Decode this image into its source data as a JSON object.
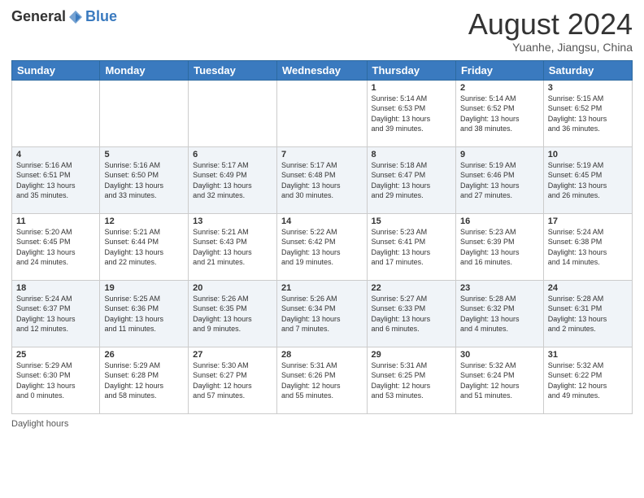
{
  "logo": {
    "general": "General",
    "blue": "Blue"
  },
  "header": {
    "month": "August 2024",
    "location": "Yuanhe, Jiangsu, China"
  },
  "days_of_week": [
    "Sunday",
    "Monday",
    "Tuesday",
    "Wednesday",
    "Thursday",
    "Friday",
    "Saturday"
  ],
  "legend": {
    "label": "Daylight hours"
  },
  "weeks": [
    [
      {
        "day": "",
        "info": ""
      },
      {
        "day": "",
        "info": ""
      },
      {
        "day": "",
        "info": ""
      },
      {
        "day": "",
        "info": ""
      },
      {
        "day": "1",
        "info": "Sunrise: 5:14 AM\nSunset: 6:53 PM\nDaylight: 13 hours\nand 39 minutes."
      },
      {
        "day": "2",
        "info": "Sunrise: 5:14 AM\nSunset: 6:52 PM\nDaylight: 13 hours\nand 38 minutes."
      },
      {
        "day": "3",
        "info": "Sunrise: 5:15 AM\nSunset: 6:52 PM\nDaylight: 13 hours\nand 36 minutes."
      }
    ],
    [
      {
        "day": "4",
        "info": "Sunrise: 5:16 AM\nSunset: 6:51 PM\nDaylight: 13 hours\nand 35 minutes."
      },
      {
        "day": "5",
        "info": "Sunrise: 5:16 AM\nSunset: 6:50 PM\nDaylight: 13 hours\nand 33 minutes."
      },
      {
        "day": "6",
        "info": "Sunrise: 5:17 AM\nSunset: 6:49 PM\nDaylight: 13 hours\nand 32 minutes."
      },
      {
        "day": "7",
        "info": "Sunrise: 5:17 AM\nSunset: 6:48 PM\nDaylight: 13 hours\nand 30 minutes."
      },
      {
        "day": "8",
        "info": "Sunrise: 5:18 AM\nSunset: 6:47 PM\nDaylight: 13 hours\nand 29 minutes."
      },
      {
        "day": "9",
        "info": "Sunrise: 5:19 AM\nSunset: 6:46 PM\nDaylight: 13 hours\nand 27 minutes."
      },
      {
        "day": "10",
        "info": "Sunrise: 5:19 AM\nSunset: 6:45 PM\nDaylight: 13 hours\nand 26 minutes."
      }
    ],
    [
      {
        "day": "11",
        "info": "Sunrise: 5:20 AM\nSunset: 6:45 PM\nDaylight: 13 hours\nand 24 minutes."
      },
      {
        "day": "12",
        "info": "Sunrise: 5:21 AM\nSunset: 6:44 PM\nDaylight: 13 hours\nand 22 minutes."
      },
      {
        "day": "13",
        "info": "Sunrise: 5:21 AM\nSunset: 6:43 PM\nDaylight: 13 hours\nand 21 minutes."
      },
      {
        "day": "14",
        "info": "Sunrise: 5:22 AM\nSunset: 6:42 PM\nDaylight: 13 hours\nand 19 minutes."
      },
      {
        "day": "15",
        "info": "Sunrise: 5:23 AM\nSunset: 6:41 PM\nDaylight: 13 hours\nand 17 minutes."
      },
      {
        "day": "16",
        "info": "Sunrise: 5:23 AM\nSunset: 6:39 PM\nDaylight: 13 hours\nand 16 minutes."
      },
      {
        "day": "17",
        "info": "Sunrise: 5:24 AM\nSunset: 6:38 PM\nDaylight: 13 hours\nand 14 minutes."
      }
    ],
    [
      {
        "day": "18",
        "info": "Sunrise: 5:24 AM\nSunset: 6:37 PM\nDaylight: 13 hours\nand 12 minutes."
      },
      {
        "day": "19",
        "info": "Sunrise: 5:25 AM\nSunset: 6:36 PM\nDaylight: 13 hours\nand 11 minutes."
      },
      {
        "day": "20",
        "info": "Sunrise: 5:26 AM\nSunset: 6:35 PM\nDaylight: 13 hours\nand 9 minutes."
      },
      {
        "day": "21",
        "info": "Sunrise: 5:26 AM\nSunset: 6:34 PM\nDaylight: 13 hours\nand 7 minutes."
      },
      {
        "day": "22",
        "info": "Sunrise: 5:27 AM\nSunset: 6:33 PM\nDaylight: 13 hours\nand 6 minutes."
      },
      {
        "day": "23",
        "info": "Sunrise: 5:28 AM\nSunset: 6:32 PM\nDaylight: 13 hours\nand 4 minutes."
      },
      {
        "day": "24",
        "info": "Sunrise: 5:28 AM\nSunset: 6:31 PM\nDaylight: 13 hours\nand 2 minutes."
      }
    ],
    [
      {
        "day": "25",
        "info": "Sunrise: 5:29 AM\nSunset: 6:30 PM\nDaylight: 13 hours\nand 0 minutes."
      },
      {
        "day": "26",
        "info": "Sunrise: 5:29 AM\nSunset: 6:28 PM\nDaylight: 12 hours\nand 58 minutes."
      },
      {
        "day": "27",
        "info": "Sunrise: 5:30 AM\nSunset: 6:27 PM\nDaylight: 12 hours\nand 57 minutes."
      },
      {
        "day": "28",
        "info": "Sunrise: 5:31 AM\nSunset: 6:26 PM\nDaylight: 12 hours\nand 55 minutes."
      },
      {
        "day": "29",
        "info": "Sunrise: 5:31 AM\nSunset: 6:25 PM\nDaylight: 12 hours\nand 53 minutes."
      },
      {
        "day": "30",
        "info": "Sunrise: 5:32 AM\nSunset: 6:24 PM\nDaylight: 12 hours\nand 51 minutes."
      },
      {
        "day": "31",
        "info": "Sunrise: 5:32 AM\nSunset: 6:22 PM\nDaylight: 12 hours\nand 49 minutes."
      }
    ]
  ]
}
